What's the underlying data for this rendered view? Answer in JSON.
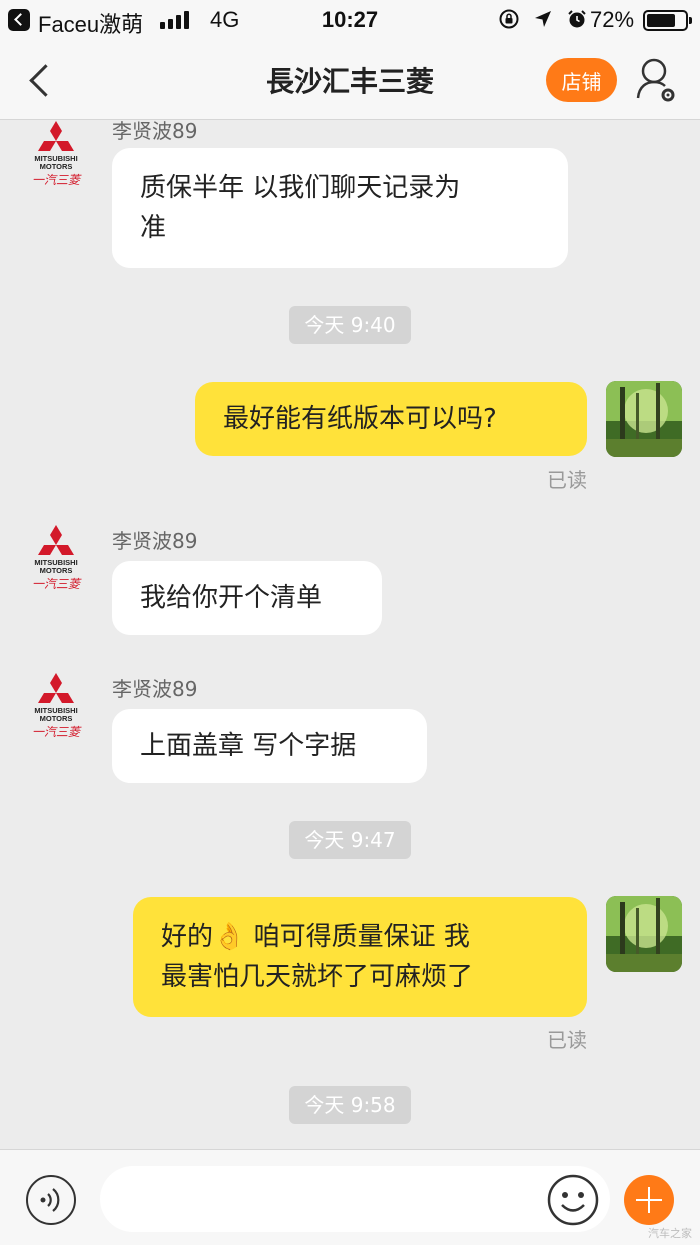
{
  "status_bar": {
    "app_name": "Faceu激萌",
    "network": "4G",
    "time": "10:27",
    "battery": "72%"
  },
  "nav": {
    "title": "長沙汇丰三菱",
    "store_label": "店铺"
  },
  "brand_avatar": {
    "text_top": "MITSUBISHI",
    "text_bottom": "MOTORS",
    "text_cn": "一汽三菱"
  },
  "messages": [
    {
      "type": "incoming",
      "sender": "李贤波89",
      "lines": [
        "质保半年 以我们聊天记录为",
        "准"
      ]
    },
    {
      "type": "time",
      "text": "今天 9:40"
    },
    {
      "type": "outgoing",
      "lines": [
        "最好能有纸版本可以吗?"
      ],
      "status": "已读"
    },
    {
      "type": "incoming",
      "sender": "李贤波89",
      "lines": [
        "我给你开个清单"
      ]
    },
    {
      "type": "incoming",
      "sender": "李贤波89",
      "lines": [
        "上面盖章  写个字据"
      ]
    },
    {
      "type": "time",
      "text": "今天 9:47"
    },
    {
      "type": "outgoing",
      "lines": [
        "好的👌  咱可得质量保证 我",
        "最害怕几天就坏了可麻烦了"
      ],
      "status": "已读"
    },
    {
      "type": "time",
      "text": "今天 9:58"
    }
  ],
  "input": {
    "placeholder": ""
  },
  "watermark": "汽车之家",
  "colors": {
    "accent": "#ff7a17",
    "outgoing_bubble": "#ffe23a",
    "incoming_bubble": "#ffffff",
    "background": "#ececec",
    "brand_red": "#d3192a"
  },
  "icons": [
    "back-icon",
    "signal-icon",
    "lock-rotation-icon",
    "location-icon",
    "alarm-icon",
    "battery-icon",
    "user-settings-icon",
    "voice-icon",
    "emoji-icon",
    "plus-icon"
  ]
}
